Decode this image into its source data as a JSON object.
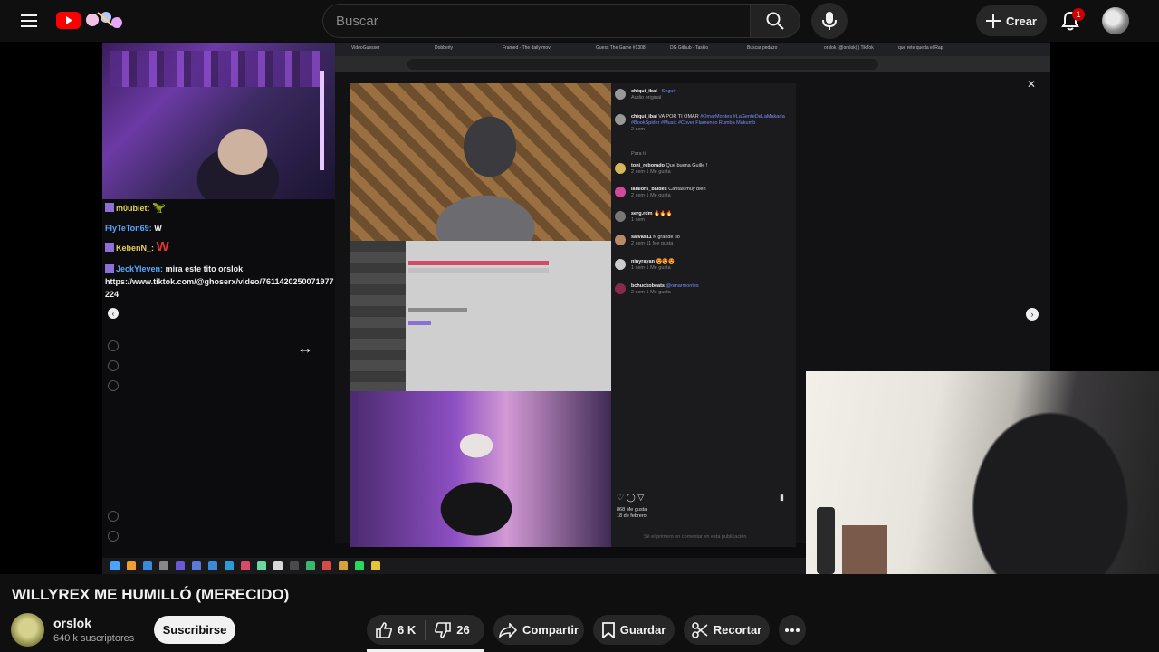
{
  "masthead": {
    "search_placeholder": "Buscar",
    "create_label": "Crear",
    "notifications_count": "1",
    "icons": [
      "menu-icon",
      "youtube-logo",
      "search-icon",
      "microphone-icon",
      "plus-icon",
      "bell-icon"
    ]
  },
  "stream": {
    "chat": [
      {
        "user": "m0ublet:",
        "message": "",
        "user_color": "#e8d25a",
        "big": ""
      },
      {
        "user": "FlyTeTon69:",
        "message": "W",
        "user_color": "#5aa9ff",
        "big": ""
      },
      {
        "user": "KebenN_:",
        "message": "",
        "user_color": "#e8d25a",
        "big": "W"
      },
      {
        "user": "JeckYleven:",
        "message": "mira este tito orslok",
        "user_color": "#5aa9ff",
        "big": ""
      }
    ],
    "chat_link_line1": "https://www.tiktok.com/@ghoserx/video/7611420250071977",
    "chat_link_line2": "224",
    "browser_tabs": [
      "VideoGuesser",
      "Dobberly",
      "Framed - The daily movi",
      "Guess The Game #1308",
      "DG Github - Taskio",
      "Buscar pedazo",
      "orslok (@orslok) | TikTok",
      "que rete queda el Rap"
    ],
    "tiktok": {
      "author": "chiqui_ibai",
      "follow": "Seguir",
      "audio": "Audio original",
      "caption_user": "chiqui_ibai",
      "caption": "VA POR TI OMAR",
      "caption_tags": "#OmarMontes #LaGenteDeLaMakaría #BookSpider #Music #Cover Flamenco Rumba Makumb",
      "caption_time": "2 sem",
      "sort_label": "Para ti",
      "comments": [
        {
          "user": "toni_reborado",
          "text": "Que buena Guille !",
          "meta": "2 sem   1 Me gusta",
          "color": "#d8b45a"
        },
        {
          "user": "lalalors_baldes",
          "text": "Cantas muy bien",
          "meta": "2 sem   1 Me gusta",
          "color": "#d14b9a"
        },
        {
          "user": "serg.rdm",
          "text": "🔥🔥🔥",
          "meta": "1 sem",
          "color": "#777"
        },
        {
          "user": "salvas11",
          "text": "K grande tio",
          "meta": "2 sem   11 Me gusta",
          "color": "#b98a6a"
        },
        {
          "user": "ninyrayan",
          "text": "😍😍😍",
          "meta": "1 sem   1 Me gusta",
          "color": "#ccc"
        },
        {
          "user": "bchuckobeats",
          "text": "@omarmontes",
          "meta": "2 sem   1 Me gusta",
          "color": "#8a2a4a"
        }
      ],
      "likes_label": "868 Me gusta",
      "date_label": "18 de febrero",
      "comment_placeholder": "Sé el primero en comentar en esta publicación"
    }
  },
  "video": {
    "title": "WILLYREX ME HUMILLÓ (MERECIDO)",
    "channel_name": "orslok",
    "subscribers": "640 k suscriptores",
    "subscribe_label": "Suscribirse",
    "likes": "6 K",
    "dislikes": "26",
    "share_label": "Compartir",
    "save_label": "Guardar",
    "clip_label": "Recortar",
    "watched_fraction": 0.1
  }
}
